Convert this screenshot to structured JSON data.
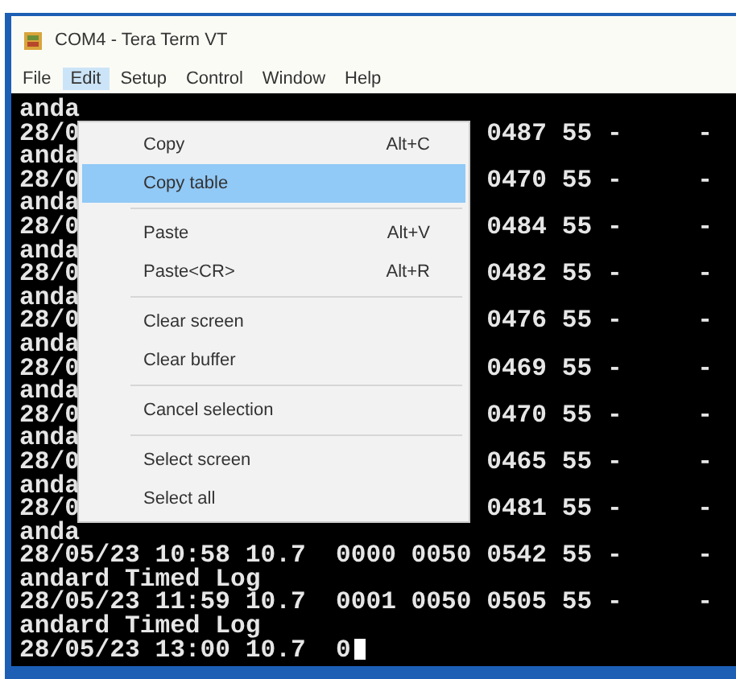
{
  "window": {
    "title": "COM4 - Tera Term VT"
  },
  "menu_bar": [
    {
      "label": "File",
      "selected": false
    },
    {
      "label": "Edit",
      "selected": true
    },
    {
      "label": "Setup",
      "selected": false
    },
    {
      "label": "Control",
      "selected": false
    },
    {
      "label": "Window",
      "selected": false
    },
    {
      "label": "Help",
      "selected": false
    }
  ],
  "edit_menu": [
    {
      "kind": "item",
      "label": "Copy",
      "shortcut": "Alt+C",
      "selected": false
    },
    {
      "kind": "item",
      "label": "Copy table",
      "selected": true
    },
    {
      "kind": "separator"
    },
    {
      "kind": "item",
      "label": "Paste",
      "shortcut": "Alt+V",
      "selected": false
    },
    {
      "kind": "item",
      "label": "Paste<CR>",
      "shortcut": "Alt+R",
      "selected": false
    },
    {
      "kind": "separator"
    },
    {
      "kind": "item",
      "label": "Clear screen",
      "selected": false
    },
    {
      "kind": "item",
      "label": "Clear buffer",
      "selected": false
    },
    {
      "kind": "separator"
    },
    {
      "kind": "item",
      "label": "Cancel selection",
      "selected": false
    },
    {
      "kind": "separator"
    },
    {
      "kind": "item",
      "label": "Select screen",
      "selected": false
    },
    {
      "kind": "item",
      "label": "Select all",
      "selected": false
    }
  ],
  "terminal": {
    "lines": [
      {
        "left": "anda"
      },
      {
        "left": "28/0",
        "right": "0487 55 -     -"
      },
      {
        "left": "anda"
      },
      {
        "left": "28/0",
        "right": "0470 55 -     -"
      },
      {
        "left": "anda"
      },
      {
        "left": "28/0",
        "right": "0484 55 -     -"
      },
      {
        "left": "anda"
      },
      {
        "left": "28/0",
        "right": "0482 55 -     -"
      },
      {
        "left": "anda"
      },
      {
        "left": "28/0",
        "right": "0476 55 -     -"
      },
      {
        "left": "anda"
      },
      {
        "left": "28/0",
        "right": "0469 55 -     -"
      },
      {
        "left": "anda"
      },
      {
        "left": "28/0",
        "right": "0470 55 -     -"
      },
      {
        "left": "anda"
      },
      {
        "left": "28/0",
        "right": "0465 55 -     -"
      },
      {
        "left": "anda"
      },
      {
        "left": "28/0",
        "right": "0481 55 -     -"
      },
      {
        "left": "anda"
      },
      {
        "left": "28/05/23 10:58 10.7  0000 0050 0542 55 -     -"
      },
      {
        "left": "andard Timed Log"
      },
      {
        "left": "28/05/23 11:59 10.7  0001 0050 0505 55 -     -"
      },
      {
        "left": "andard Timed Log"
      },
      {
        "left": "28/05/23 13:00 10.7  0",
        "cursor": true
      }
    ]
  }
}
